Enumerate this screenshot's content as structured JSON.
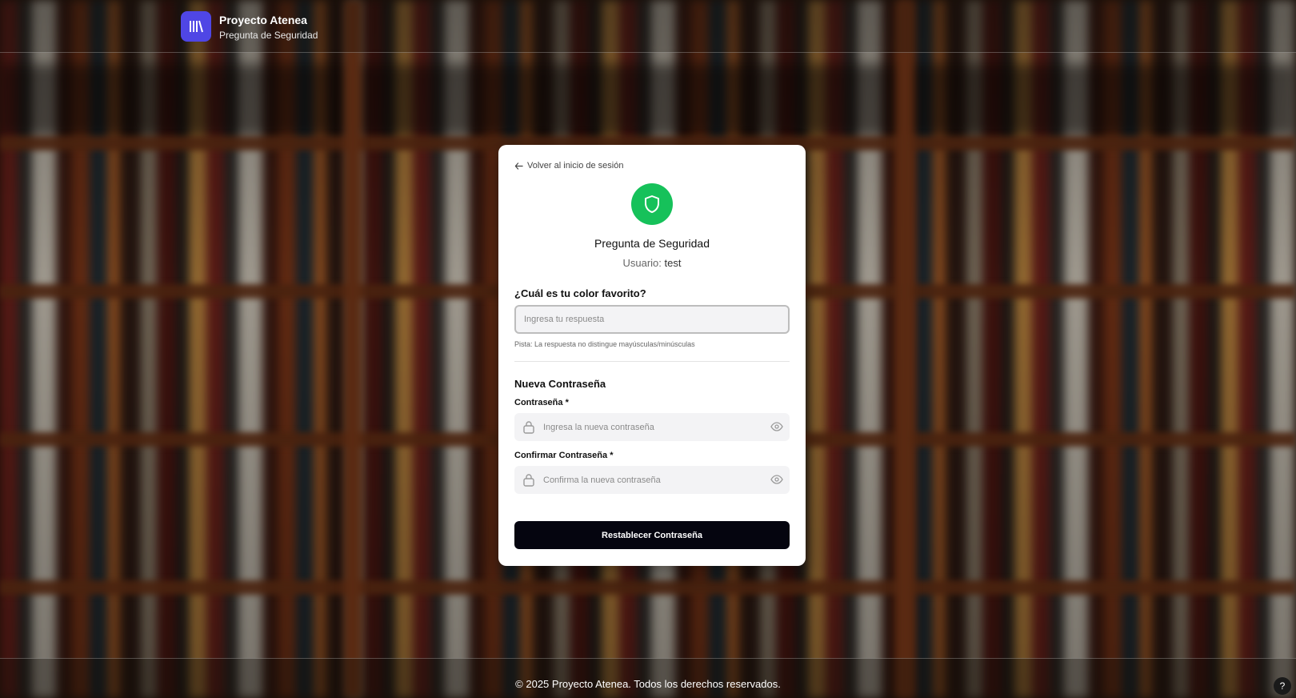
{
  "header": {
    "app_name": "Proyecto Atenea",
    "subtitle": "Pregunta de Seguridad"
  },
  "card": {
    "back_link": "Volver al inicio de sesión",
    "title": "Pregunta de Seguridad",
    "user_label": "Usuario:",
    "user_name": "test",
    "question": "¿Cuál es tu color favorito?",
    "answer_placeholder": "Ingresa tu respuesta",
    "answer_value": "",
    "hint": "Pista: La respuesta no distingue mayúsculas/minúsculas",
    "new_password_title": "Nueva Contraseña",
    "password_label": "Contraseña *",
    "password_placeholder": "Ingresa la nueva contraseña",
    "confirm_label": "Confirmar Contraseña *",
    "confirm_placeholder": "Confirma la nueva contraseña",
    "submit_label": "Restablecer Contraseña"
  },
  "footer": {
    "text": "© 2025 Proyecto Atenea. Todos los derechos reservados."
  },
  "help": {
    "label": "?"
  },
  "colors": {
    "brand": "#4f46e5",
    "success": "#16c15a",
    "button": "#05050f"
  },
  "icons": {
    "logo": "library-icon",
    "back": "arrow-left-icon",
    "shield": "shield-icon",
    "lock": "lock-icon",
    "eye": "eye-icon"
  }
}
